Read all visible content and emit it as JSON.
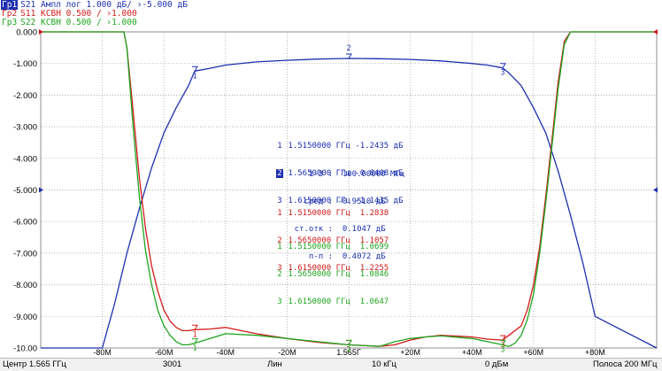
{
  "traces": [
    {
      "tag": "Гр1",
      "text": "S21 Ампл лог 1.000 дБ/ ›-5.000 дБ",
      "color": "#1c2fb0"
    },
    {
      "tag": "Гр2",
      "text": "S11 КСВН 0.500 / ›1.000",
      "color": "#d21a1a"
    },
    {
      "tag": "Гр3",
      "text": "S22 КСВН 0.500 / ›1.000",
      "color": "#1ea51e"
    }
  ],
  "y_ticks": [
    "0.000",
    "-1.000",
    "-2.000",
    "-3.000",
    "-4.000",
    "-5.000",
    "-6.000",
    "-7.000",
    "-8.000",
    "-9.000",
    "-10.00"
  ],
  "x_ticks": [
    {
      "label": "-80M",
      "value": -80
    },
    {
      "label": "-60M",
      "value": -60
    },
    {
      "label": "-40M",
      "value": -40
    },
    {
      "label": "-20M",
      "value": -20
    },
    {
      "label": "1.565Г",
      "value": 0
    },
    {
      "label": "+20M",
      "value": 20
    },
    {
      "label": "+40M",
      "value": 40
    },
    {
      "label": "+60M",
      "value": 60
    },
    {
      "label": "+80M",
      "value": 80
    }
  ],
  "markers": {
    "s21": [
      {
        "num": "1",
        "freq": "1.5150000 ГГц",
        "value": "-1.2435 дБ",
        "active": false
      },
      {
        "num": "2",
        "freq": "1.5650000 ГГц",
        "value": "-0.8408 дБ",
        "active": true
      },
      {
        "num": "3",
        "freq": "1.6150000 ГГц",
        "value": "-1.1435 дБ",
        "active": false
      }
    ],
    "stats": [
      {
        "label": "1-3 :",
        "value": "100.00000 МГц"
      },
      {
        "label": "сред :",
        "value": "-0.9510 дБ"
      },
      {
        "label": "ст.отк :",
        "value": "0.1047 дБ"
      },
      {
        "label": "п-п :",
        "value": "0.4072 дБ"
      }
    ],
    "s11": [
      {
        "num": "1",
        "freq": "1.5150000 ГГц",
        "value": "1.2838"
      },
      {
        "num": "2",
        "freq": "1.5650000 ГГц",
        "value": "1.1057"
      },
      {
        "num": "3",
        "freq": "1.6150000 ГГц",
        "value": "1.2255"
      }
    ],
    "s22": [
      {
        "num": "1",
        "freq": "1.5150000 ГГц",
        "value": "1.0699"
      },
      {
        "num": "2",
        "freq": "1.5650000 ГГц",
        "value": "1.0846"
      },
      {
        "num": "3",
        "freq": "1.6150000 ГГц",
        "value": "1.0647"
      }
    ]
  },
  "status": {
    "center": "Центр 1.565 ГГц",
    "points": "3001",
    "sweep": "Лин",
    "ifbw": "10 кГц",
    "power": "0 дБм",
    "span": "Полоса 200 МГц"
  },
  "colors": {
    "s21": "#1c2fb0",
    "s11": "#d21a1a",
    "s22": "#1ea51e",
    "grid": "#9a9a9a"
  },
  "chart_data": {
    "type": "line",
    "x_unit": "МГц offset from center 1.565 ГГц",
    "xlim": [
      -100,
      100
    ],
    "ylim": [
      -10,
      0
    ],
    "series": [
      {
        "name": "S21",
        "x": [
          -100,
          -80,
          -76,
          -72,
          -68,
          -64,
          -60,
          -56,
          -52,
          -50,
          -45,
          -40,
          -30,
          -20,
          -10,
          0,
          10,
          20,
          30,
          40,
          45,
          50,
          52,
          56,
          60,
          64,
          68,
          72,
          76,
          80,
          100
        ],
        "y": [
          -10,
          -10,
          -8.6,
          -7.0,
          -5.6,
          -4.3,
          -3.2,
          -2.4,
          -1.7,
          -1.24,
          -1.15,
          -1.05,
          -0.95,
          -0.9,
          -0.86,
          -0.84,
          -0.85,
          -0.87,
          -0.92,
          -1.0,
          -1.05,
          -1.14,
          -1.3,
          -1.7,
          -2.4,
          -3.2,
          -4.4,
          -5.8,
          -7.3,
          -9.0,
          -10
        ]
      },
      {
        "name": "S11",
        "x": [
          -100,
          -73,
          -72,
          -70,
          -68,
          -66,
          -64,
          -62,
          -60,
          -58,
          -56,
          -54,
          -52,
          -50,
          -45,
          -40,
          -30,
          -20,
          -10,
          0,
          10,
          15,
          20,
          25,
          30,
          40,
          45,
          50,
          52,
          56,
          58,
          60,
          62,
          64,
          66,
          68,
          70,
          72,
          100
        ],
        "y": [
          0,
          0,
          -0.5,
          -2.5,
          -4.6,
          -6.2,
          -7.4,
          -8.2,
          -8.8,
          -9.15,
          -9.35,
          -9.45,
          -9.45,
          -9.42,
          -9.4,
          -9.35,
          -9.55,
          -9.7,
          -9.82,
          -9.9,
          -9.95,
          -9.9,
          -9.75,
          -9.65,
          -9.6,
          -9.65,
          -9.72,
          -9.75,
          -9.6,
          -9.3,
          -8.8,
          -8.0,
          -6.8,
          -5.2,
          -3.4,
          -1.6,
          -0.3,
          0,
          0
        ]
      },
      {
        "name": "S22",
        "x": [
          -100,
          -73,
          -72,
          -70,
          -68,
          -66,
          -64,
          -62,
          -60,
          -58,
          -56,
          -54,
          -52,
          -50,
          -45,
          -40,
          -30,
          -20,
          -10,
          0,
          10,
          15,
          20,
          25,
          30,
          40,
          45,
          50,
          52,
          54,
          56,
          58,
          60,
          62,
          64,
          66,
          68,
          70,
          72,
          100
        ],
        "y": [
          0,
          0,
          -0.5,
          -3.0,
          -5.2,
          -6.9,
          -8.0,
          -8.8,
          -9.3,
          -9.6,
          -9.8,
          -9.9,
          -9.9,
          -9.85,
          -9.7,
          -9.55,
          -9.6,
          -9.7,
          -9.8,
          -9.9,
          -9.95,
          -9.8,
          -9.7,
          -9.65,
          -9.62,
          -9.7,
          -9.8,
          -9.9,
          -9.95,
          -9.85,
          -9.6,
          -9.1,
          -8.3,
          -7.0,
          -5.4,
          -3.6,
          -1.8,
          -0.4,
          0,
          0
        ]
      }
    ]
  }
}
